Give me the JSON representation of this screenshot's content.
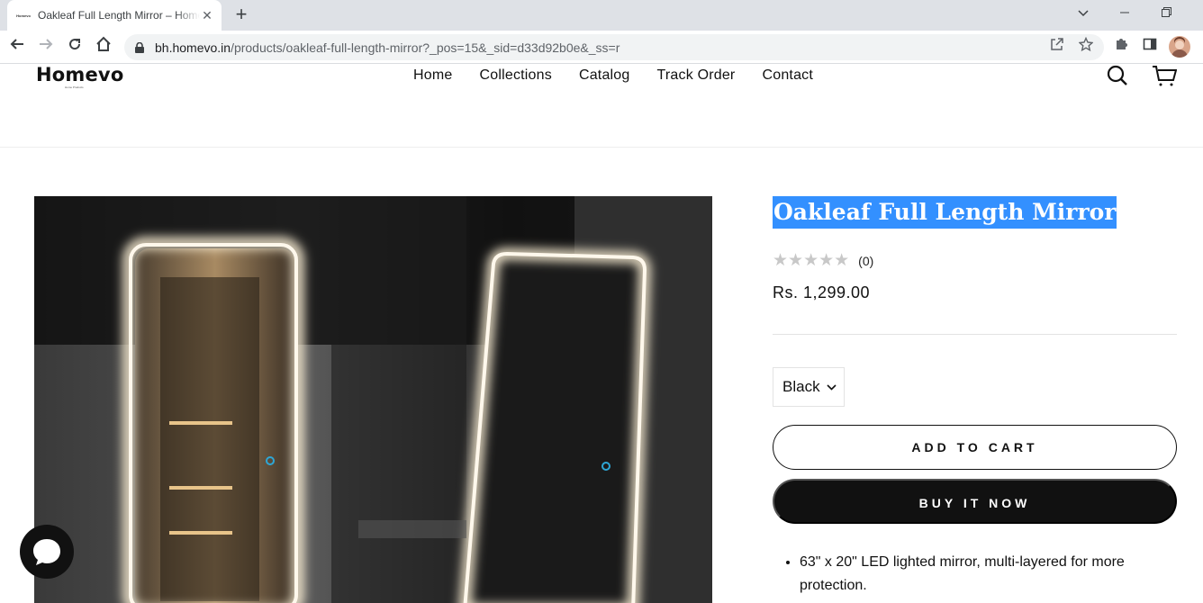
{
  "browser": {
    "tab_title": "Oakleaf Full Length Mirror – Homevo",
    "tab_favicon_text": "Homevo",
    "url_host": "bh.homevo.in",
    "url_path": "/products/oakleaf-full-length-mirror?_pos=15&_sid=d33d92b0e&_ss=r"
  },
  "site": {
    "logo_text": "Homevo",
    "logo_tagline": "Home Products",
    "nav": [
      "Home",
      "Collections",
      "Catalog",
      "Track Order",
      "Contact"
    ]
  },
  "product": {
    "title": "Oakleaf Full Length Mirror",
    "rating_stars": 0,
    "rating_count": "(0)",
    "price": "Rs. 1,299.00",
    "variant": "Black",
    "add_to_cart": "ADD TO CART",
    "buy_now": "BUY IT NOW",
    "features": [
      "63\" x 20\" LED lighted mirror, multi-layered for more protection."
    ]
  },
  "colors": {
    "selection": "#3390ff",
    "button_dark": "#111111",
    "star_empty": "#c8c8c8"
  },
  "icons": {
    "search": "search-icon",
    "cart": "cart-icon",
    "chat": "chat-icon"
  }
}
